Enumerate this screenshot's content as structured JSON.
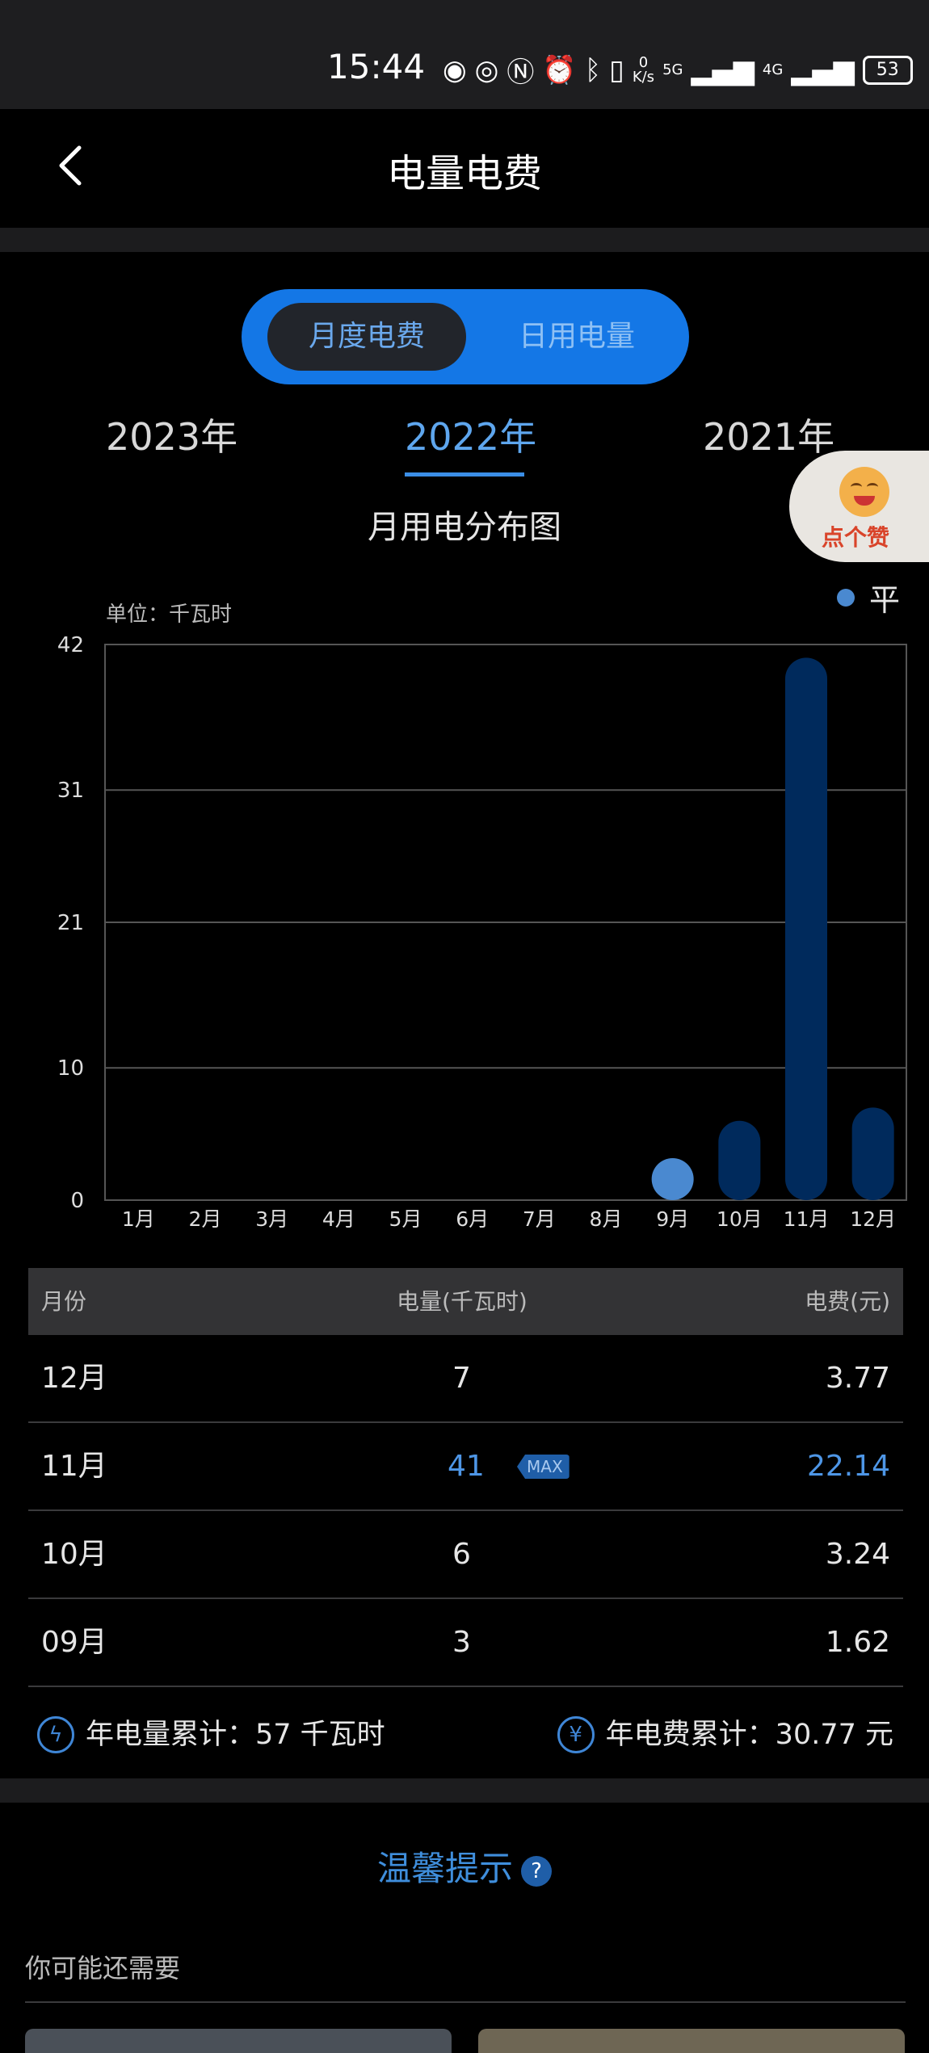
{
  "status_bar": {
    "time": "15:44",
    "net_speed_value": "0",
    "net_speed_unit": "K/s",
    "signal_1_label": "5G",
    "signal_2_label": "4G",
    "battery": "53"
  },
  "nav": {
    "title": "电量电费",
    "back_icon": "chevron-left-icon"
  },
  "toggle": {
    "monthly_label": "月度电费",
    "daily_label": "日用电量",
    "selected": "月度电费"
  },
  "years": {
    "items": [
      "2023年",
      "2022年",
      "2021年"
    ],
    "selected": "2022年"
  },
  "like_badge": {
    "label": "点个赞"
  },
  "chart": {
    "title": "月用电分布图",
    "unit_label": "单位：千瓦时",
    "legend": "平"
  },
  "chart_data": {
    "type": "bar",
    "categories": [
      "1月",
      "2月",
      "3月",
      "4月",
      "5月",
      "6月",
      "7月",
      "8月",
      "9月",
      "10月",
      "11月",
      "12月"
    ],
    "series": [
      {
        "name": "平",
        "values": [
          0,
          0,
          0,
          0,
          0,
          0,
          0,
          0,
          3,
          6,
          41,
          7
        ]
      }
    ],
    "y_ticks": [
      "0",
      "10",
      "21",
      "31",
      "42"
    ],
    "ylim": [
      0,
      42
    ],
    "grid": true,
    "legend_position": "top-right",
    "colors": {
      "bar": "#002a5c",
      "highlight": "#4a89d0"
    }
  },
  "table": {
    "headers": {
      "month": "月份",
      "energy": "电量(千瓦时)",
      "fee": "电费(元)"
    },
    "rows": [
      {
        "month": "12月",
        "energy": "7",
        "fee": "3.77"
      },
      {
        "month": "11月",
        "energy": "41",
        "fee": "22.14",
        "tag": "MAX"
      },
      {
        "month": "10月",
        "energy": "6",
        "fee": "3.24"
      },
      {
        "month": "09月",
        "energy": "3",
        "fee": "1.62"
      }
    ]
  },
  "totals": {
    "energy_label": "年电量累计：57 千瓦时",
    "fee_label": "年电费累计：30.77 元",
    "energy_icon": "lightning-icon",
    "fee_icon": "yen-icon"
  },
  "tips": {
    "title": "温馨提示",
    "help_glyph": "?"
  },
  "recommend": {
    "label": "你可能还需要"
  },
  "colors": {
    "accent": "#1477e6",
    "highlight_text": "#4e96e6",
    "background": "#000000"
  }
}
